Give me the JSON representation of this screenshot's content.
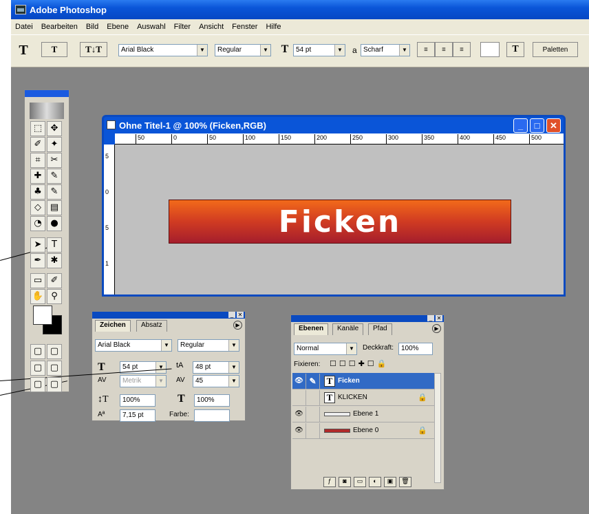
{
  "app": {
    "title": "Adobe Photoshop"
  },
  "menu": [
    "Datei",
    "Bearbeiten",
    "Bild",
    "Ebene",
    "Auswahl",
    "Filter",
    "Ansicht",
    "Fenster",
    "Hilfe"
  ],
  "options": {
    "font": "Arial Black",
    "style": "Regular",
    "size": "54 pt",
    "aa_label": "a",
    "antialias": "Scharf",
    "palettes": "Paletten"
  },
  "document": {
    "title": "Ohne Titel-1 @ 100% (Ficken,RGB)",
    "banner_text": "Ficken",
    "ruler_h": [
      "50",
      "0",
      "50",
      "100",
      "150",
      "200",
      "250",
      "300",
      "350",
      "400",
      "450",
      "500"
    ],
    "ruler_v": [
      "5",
      "0",
      "5",
      "1"
    ]
  },
  "char": {
    "tabs": [
      "Zeichen",
      "Absatz"
    ],
    "font": "Arial Black",
    "style": "Regular",
    "size": "54 pt",
    "leading": "48 pt",
    "kerning": "Metrik",
    "tracking": "45",
    "vscale": "100%",
    "hscale": "100%",
    "baseline": "7,15 pt",
    "color_label": "Farbe:"
  },
  "layers": {
    "tabs": [
      "Ebenen",
      "Kanäle",
      "Pfad"
    ],
    "mode": "Normal",
    "opacity_label": "Deckkraft:",
    "opacity": "100%",
    "lock_label": "Fixieren:",
    "items": [
      {
        "name": "Ficken",
        "kind": "text",
        "selected": true,
        "visible": true
      },
      {
        "name": "KLICKEN",
        "kind": "text",
        "selected": false,
        "visible": false,
        "locked": true
      },
      {
        "name": "Ebene 1",
        "kind": "image",
        "selected": false,
        "visible": true
      },
      {
        "name": "Ebene 0",
        "kind": "image",
        "selected": false,
        "visible": true,
        "locked": true
      }
    ]
  }
}
